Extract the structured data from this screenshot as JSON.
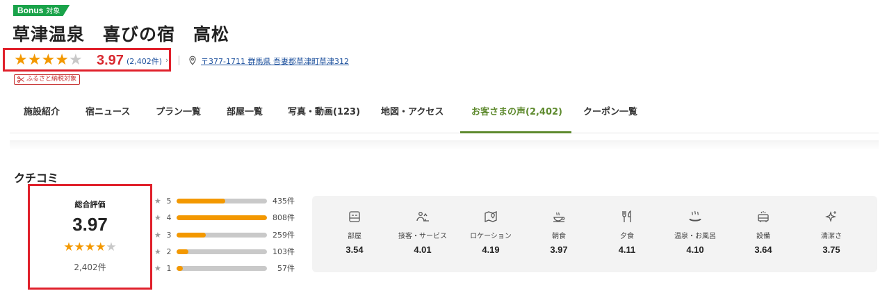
{
  "badge": {
    "bonus": "Bonus",
    "bonus_sub": "対象"
  },
  "hotel": {
    "name": "草津温泉　喜びの宿　高松"
  },
  "rating": {
    "score": "3.97",
    "count": "(2,402件)",
    "stars_filled": 4,
    "stars_total": 5
  },
  "address": "〒377-1711 群馬県 吾妻郡草津町草津312",
  "furusato_label": "ふるさと納税対象",
  "tabs": [
    {
      "label": "施設紹介"
    },
    {
      "label": "宿ニュース"
    },
    {
      "label": "プラン一覧"
    },
    {
      "label": "部屋一覧"
    },
    {
      "label": "写真・動画(123)"
    },
    {
      "label": "地図・アクセス"
    },
    {
      "label": "お客さまの声(2,402)",
      "active": true
    },
    {
      "label": "クーポン一覧"
    }
  ],
  "reviews": {
    "heading": "クチコミ",
    "overall_label": "総合評価",
    "overall_score": "3.97",
    "overall_count": "2,402件",
    "distribution": [
      {
        "star": "5",
        "count": "435件",
        "ratio": 0.54
      },
      {
        "star": "4",
        "count": "808件",
        "ratio": 1.0
      },
      {
        "star": "3",
        "count": "259件",
        "ratio": 0.32
      },
      {
        "star": "2",
        "count": "103件",
        "ratio": 0.13
      },
      {
        "star": "1",
        "count": "57件",
        "ratio": 0.07
      }
    ],
    "categories": [
      {
        "label": "部屋",
        "score": "3.54",
        "icon": "bed-icon"
      },
      {
        "label": "接客・サービス",
        "score": "4.01",
        "icon": "service-icon"
      },
      {
        "label": "ロケーション",
        "score": "4.19",
        "icon": "map-pin-icon"
      },
      {
        "label": "朝食",
        "score": "3.97",
        "icon": "breakfast-icon"
      },
      {
        "label": "夕食",
        "score": "4.11",
        "icon": "dinner-icon"
      },
      {
        "label": "温泉・お風呂",
        "score": "4.10",
        "icon": "onsen-icon"
      },
      {
        "label": "設備",
        "score": "3.64",
        "icon": "facility-icon"
      },
      {
        "label": "清潔さ",
        "score": "3.75",
        "icon": "sparkle-icon"
      }
    ]
  },
  "colors": {
    "accent_green": "#5e8a2e",
    "star_orange": "#f39800",
    "highlight_red": "#e0202b",
    "rating_red": "#d8282f"
  }
}
